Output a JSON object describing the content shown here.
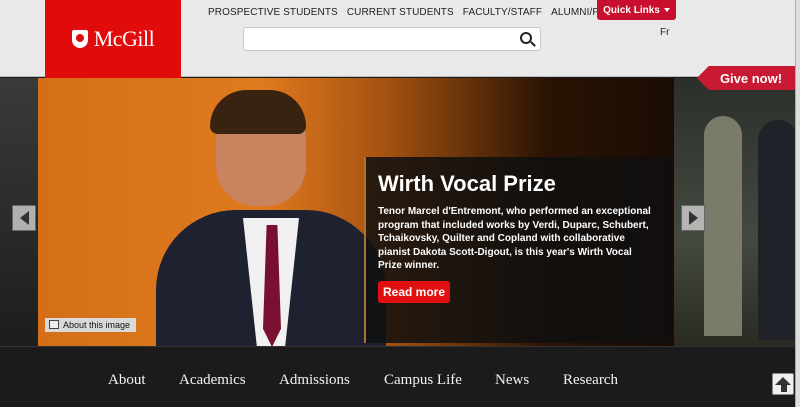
{
  "header": {
    "logo_text": "McGill",
    "audience_links": [
      "PROSPECTIVE STUDENTS",
      "CURRENT STUDENTS",
      "FACULTY/STAFF",
      "ALUMNI/PARENTS"
    ],
    "search": {
      "placeholder": "",
      "value": ""
    },
    "quick_links_label": "Quick Links",
    "language_toggle": "Fr"
  },
  "give_now": "Give now!",
  "hero": {
    "title": "Wirth Vocal Prize",
    "body": "Tenor Marcel d'Entremont, who performed an exceptional program that included works by Verdi, Duparc, Schubert, Tchaikovsky, Quilter and Copland with collaborative pianist Dakota Scott-Digout, is this year's Wirth Vocal Prize winner.",
    "read_more": "Read more",
    "about_image": "About this image"
  },
  "footer_nav": [
    "About",
    "Academics",
    "Admissions",
    "Campus Life",
    "News",
    "Research"
  ],
  "colors": {
    "brand_red": "#e00b0b",
    "give_now_red": "#c81a32",
    "read_more_red": "#e01010"
  }
}
